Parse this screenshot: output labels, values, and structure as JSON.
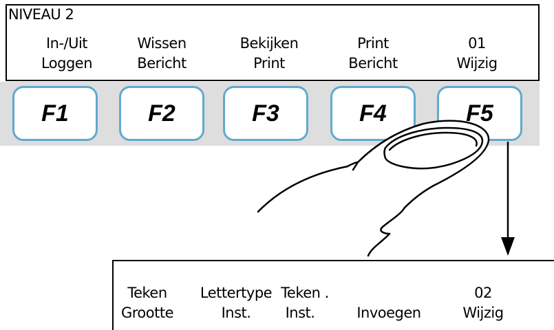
{
  "level": "NIVEAU 2",
  "top_menu": [
    {
      "line1": "In-/Uit",
      "line2": "Loggen"
    },
    {
      "line1": "Wissen",
      "line2": "Bericht"
    },
    {
      "line1": "Bekijken",
      "line2": "Print"
    },
    {
      "line1": "Print",
      "line2": "Bericht"
    },
    {
      "line1": "01",
      "line2": "Wijzig"
    }
  ],
  "function_keys": [
    "F1",
    "F2",
    "F3",
    "F4",
    "F5"
  ],
  "bottom_menu": [
    {
      "line1": "Teken",
      "line2": "Grootte"
    },
    {
      "line1": "Lettertype",
      "line2": "Inst."
    },
    {
      "line1": "Teken .",
      "line2": "Inst."
    },
    {
      "line1": "",
      "line2": "Invoegen"
    },
    {
      "line1": "02",
      "line2": "Wijzig"
    }
  ],
  "colors": {
    "key_border": "#5fa9d0",
    "key_strip": "#dedede"
  },
  "icons": {
    "finger": "pointing-finger-icon",
    "arrow": "arrow-down-icon"
  }
}
